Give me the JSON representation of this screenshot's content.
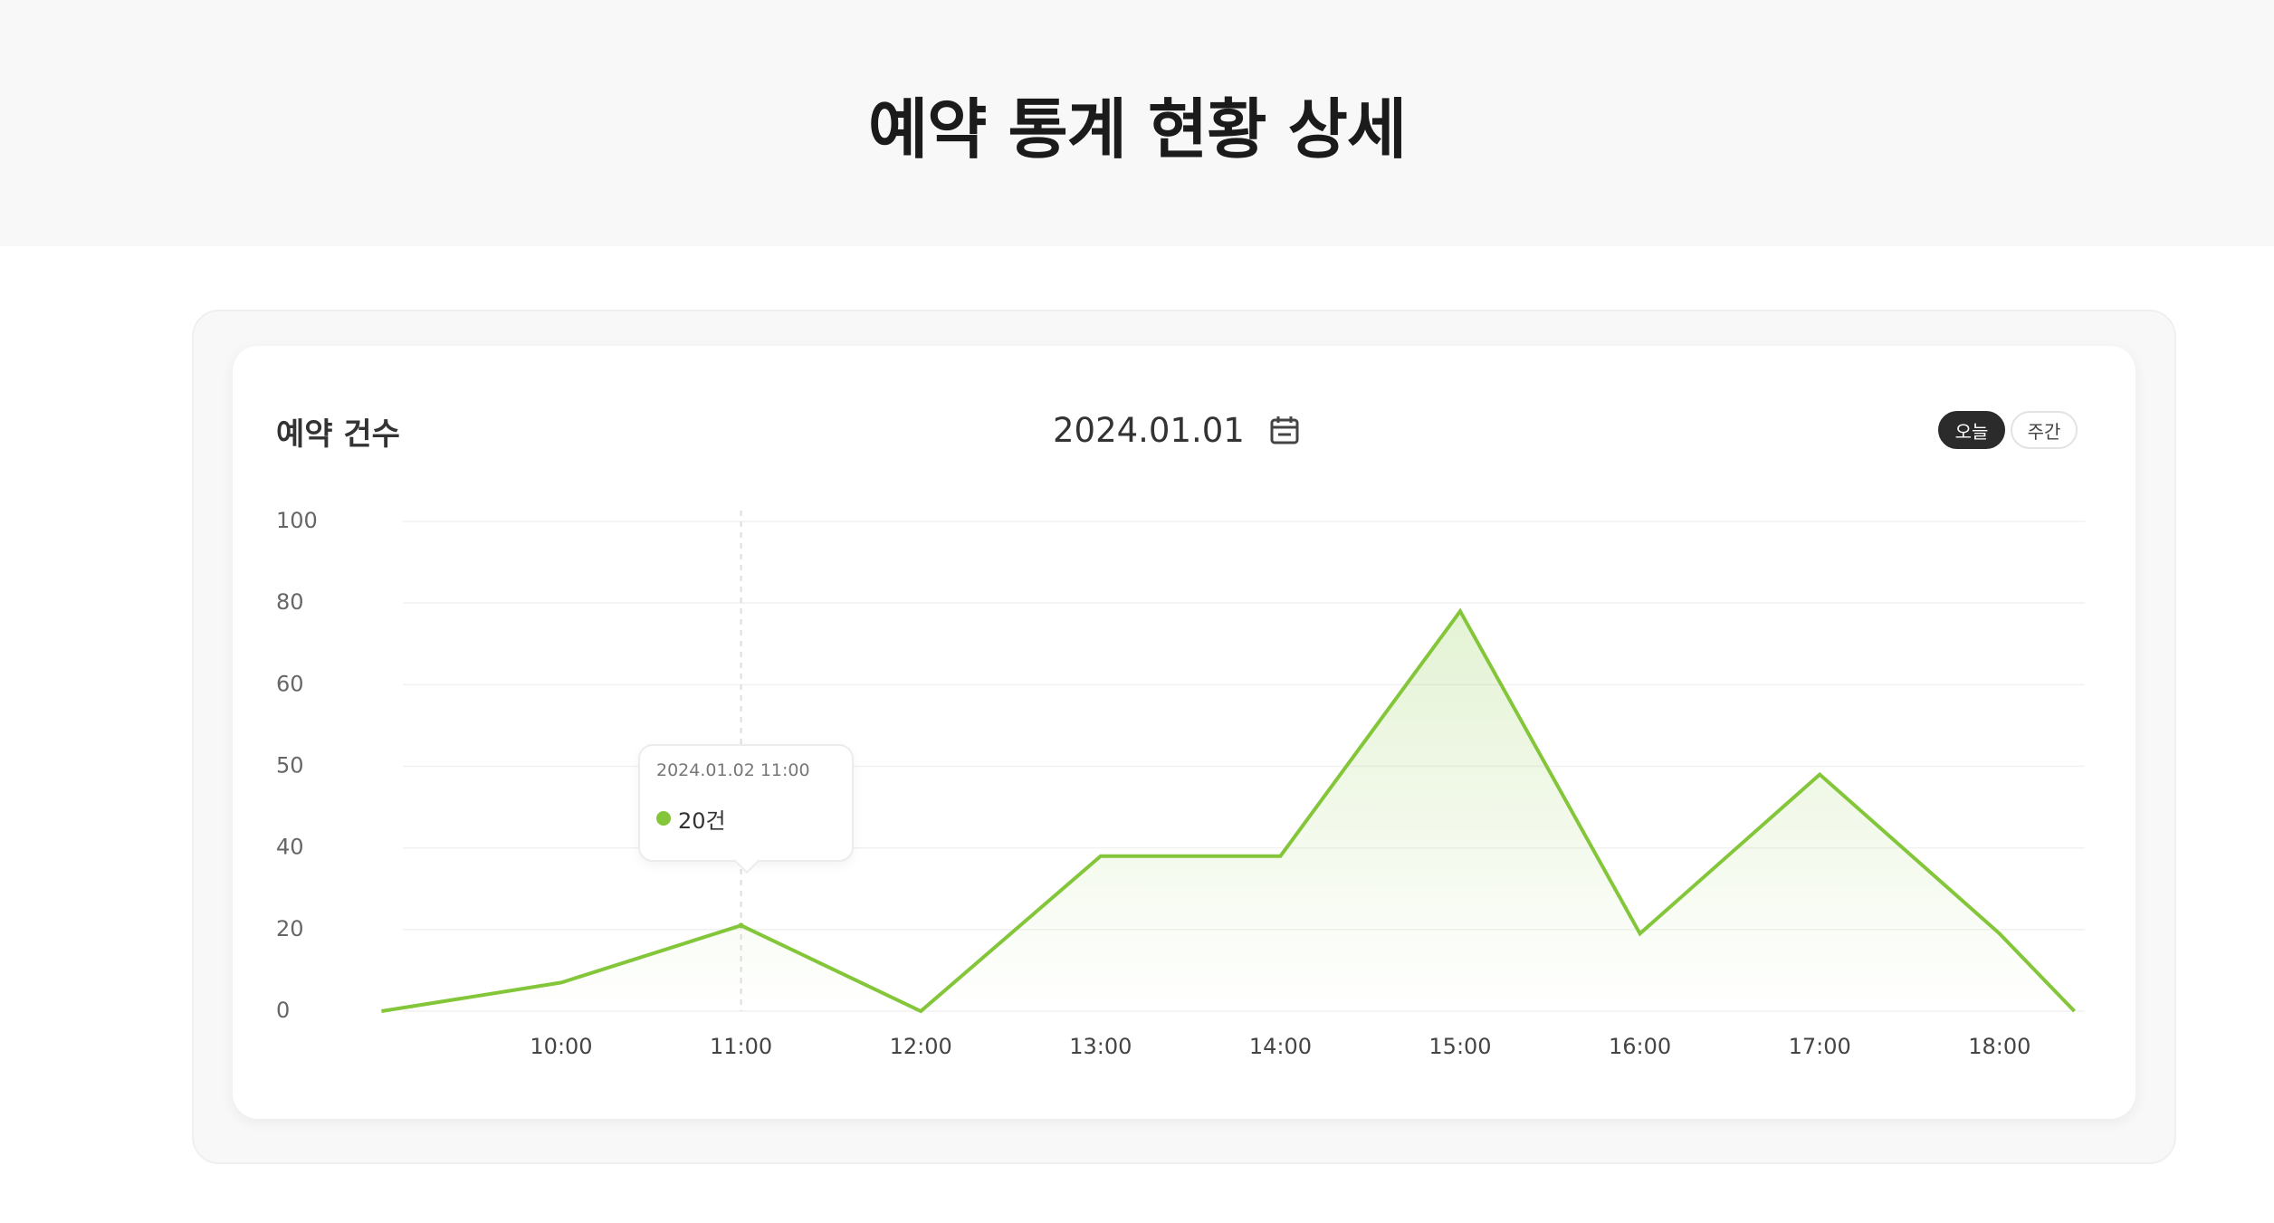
{
  "page": {
    "title": "예약 통계 현황 상세"
  },
  "card": {
    "title": "예약 건수",
    "date": "2024.01.01",
    "period_buttons": [
      {
        "label": "오늘",
        "active": true
      },
      {
        "label": "주간",
        "active": false
      }
    ]
  },
  "tooltip": {
    "date": "2024.01.02 11:00",
    "value": "20건"
  },
  "colors": {
    "line": "#84c63a",
    "fill": "#e6f3d8",
    "active_button": "#2b2b2b"
  },
  "icons": {
    "date_picker": "calendar-icon"
  },
  "chart_data": {
    "type": "line",
    "x": [
      "09:00",
      "10:00",
      "11:00",
      "12:00",
      "13:00",
      "14:00",
      "15:00",
      "16:00",
      "17:00",
      "18:00",
      "18:25"
    ],
    "x_tick_labels": [
      "10:00",
      "11:00",
      "12:00",
      "13:00",
      "14:00",
      "15:00",
      "16:00",
      "17:00",
      "18:00"
    ],
    "y_tick_labels": [
      "100",
      "80",
      "60",
      "50",
      "40",
      "20",
      "0"
    ],
    "series": [
      {
        "values": [
          0,
          7,
          21,
          0,
          38,
          38,
          78,
          19,
          49,
          19,
          0
        ]
      }
    ],
    "highlight": {
      "x": "11:00",
      "value": 20
    },
    "ylim": [
      0,
      100
    ],
    "grid": true,
    "legend": "none"
  }
}
